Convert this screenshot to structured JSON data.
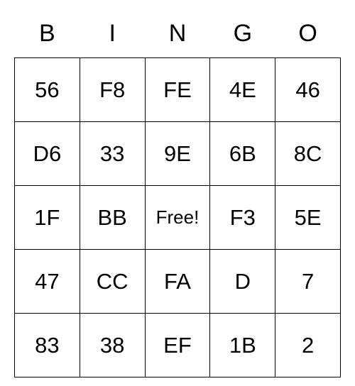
{
  "headers": [
    "B",
    "I",
    "N",
    "G",
    "O"
  ],
  "grid": [
    [
      "56",
      "F8",
      "FE",
      "4E",
      "46"
    ],
    [
      "D6",
      "33",
      "9E",
      "6B",
      "8C"
    ],
    [
      "1F",
      "BB",
      "Free!",
      "F3",
      "5E"
    ],
    [
      "47",
      "CC",
      "FA",
      "D",
      "7"
    ],
    [
      "83",
      "38",
      "EF",
      "1B",
      "2"
    ]
  ]
}
